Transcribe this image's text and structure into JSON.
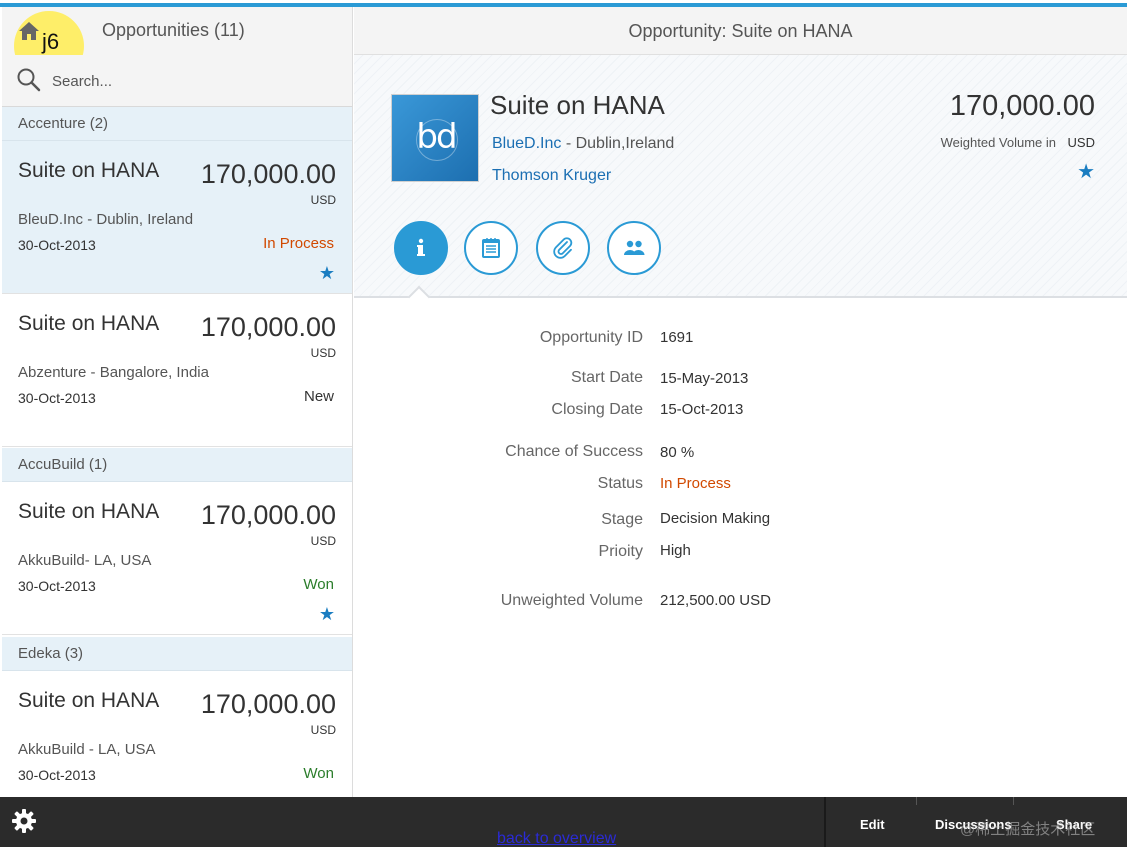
{
  "master": {
    "title": "Opportunities (11)",
    "overlay_text": "j6",
    "search_placeholder": "Search...",
    "groups": [
      {
        "label": "Accenture (2)"
      },
      {
        "label": "AccuBuild (1)"
      },
      {
        "label": "Edeka (3)"
      }
    ],
    "items": [
      {
        "title": "Suite on HANA",
        "amount": "170,000.00",
        "unit": "USD",
        "sub": "BleuD.Inc - Dublin, Ireland",
        "date": "30-Oct-2013",
        "status": "In Process",
        "star": "★"
      },
      {
        "title": "Suite on HANA",
        "amount": "170,000.00",
        "unit": "USD",
        "sub": "Abzenture - Bangalore, India",
        "date": "30-Oct-2013",
        "status": "New"
      },
      {
        "title": "Suite on HANA",
        "amount": "170,000.00",
        "unit": "USD",
        "sub": "AkkuBuild- LA, USA",
        "date": "30-Oct-2013",
        "status": "Won",
        "star": "★"
      },
      {
        "title": "Suite on HANA",
        "amount": "170,000.00",
        "unit": "USD",
        "sub": "AkkuBuild - LA, USA",
        "date": "30-Oct-2013",
        "status": "Won"
      }
    ]
  },
  "detail": {
    "header_title": "Opportunity: Suite on HANA",
    "object": {
      "logo_text": "bd",
      "title": "Suite on HANA",
      "company_link": "BlueD.Inc",
      "company_rest": " - Dublin,Ireland",
      "contact": "Thomson Kruger",
      "amount": "170,000.00",
      "weighted_label": "Weighted Volume in",
      "weighted_unit": "USD",
      "star": "★"
    },
    "fields": [
      {
        "label": "Opportunity ID",
        "value": "1691"
      },
      {
        "label": "Start Date",
        "value": "15-May-2013"
      },
      {
        "label": "Closing Date",
        "value": "15-Oct-2013"
      },
      {
        "label": "Chance of Success",
        "value": "80 %"
      },
      {
        "label": "Status",
        "value": "In Process"
      },
      {
        "label": "Stage",
        "value": "Decision Making"
      },
      {
        "label": "Prioity",
        "value": "High"
      },
      {
        "label": "Unweighted Volume",
        "value": "212,500.00 USD"
      }
    ]
  },
  "footer": {
    "edit": "Edit",
    "discussions": "Discussions",
    "share": "Share",
    "back_link": "back to overview",
    "watermark": "@稀土掘金技术社区"
  },
  "colors": {
    "accent": "#2a9ad5",
    "status_in_process": "#d14900",
    "status_won": "#2b7d2b",
    "link": "#1b6fb3"
  }
}
